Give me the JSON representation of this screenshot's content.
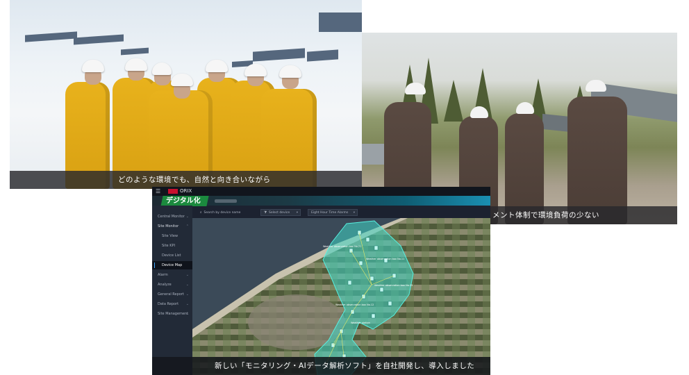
{
  "photo1": {
    "caption": "どのような環境でも、自然と向き合いながら"
  },
  "photo2": {
    "caption": "メント体制で環境負荷の少ない"
  },
  "dashboard": {
    "brand": "ORIX",
    "badge": "デジタル化",
    "caption": "新しい「モニタリング・AIデータ解析ソフト」を自社開発し、導入しました",
    "sidebar": {
      "items": [
        {
          "label": "Central Monitor",
          "expandable": true
        },
        {
          "label": "Site Monitor",
          "expandable": true,
          "heading": true
        },
        {
          "label": "Site View",
          "sub": true
        },
        {
          "label": "Site KPI",
          "sub": true
        },
        {
          "label": "Device List",
          "sub": true
        },
        {
          "label": "Device Map",
          "sub": true,
          "active": true
        },
        {
          "label": "Alarm",
          "expandable": true
        },
        {
          "label": "Analyze",
          "expandable": true
        },
        {
          "label": "General Report",
          "expandable": true
        },
        {
          "label": "Data Report",
          "expandable": true
        },
        {
          "label": "Site Management",
          "expandable": true
        }
      ]
    },
    "filters": {
      "search_placeholder": "Search by device name",
      "device_select": "Select device",
      "alarm_select": "Eight Hour Time Alarms"
    },
    "map_labels": [
      "Weather observation box No.21",
      "Weather observation box No.11",
      "Weather observation box No.15",
      "Weather observation box No.12",
      "Weather station"
    ],
    "colors": {
      "accent_green": "#1b8a3e",
      "map_overlay": "#3fd6c6",
      "dashboard_bg": "#1c2230"
    }
  }
}
